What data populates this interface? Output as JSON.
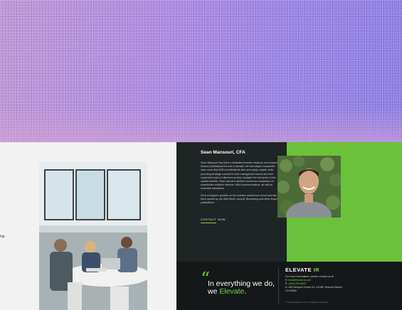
{
  "left": {
    "text_fragment": "hip"
  },
  "profile": {
    "name": "Sean Mansouri, CFA",
    "bio_1": "Sean Mansouri has been a dedicated investor relations and corporate finance professional for over a decade. He has helped companies raise more than $1B of institutional debt and equity capital, while providing strategic counsel to both management teams and their respective board of directors as they navigate the intricacies of the capital markets. Sean has also advised numerous companies on shareholder activism defense, M&A communications, as well as executive transitions.",
    "bio_2": "He is a frequent speaker on the investor conference circuit and has been quoted by the Wall Street Journal, Bloomberg and other financial publications.",
    "contact_label": "CONTACT NOW"
  },
  "quote": {
    "mark": "“",
    "line1": "In everything we do,",
    "line2_prefix": "we ",
    "line2_highlight": "Elevate",
    "line2_suffix": "."
  },
  "footer": {
    "logo_main": "ELEVATE",
    "logo_suffix": "IR",
    "intro": "For more information, please contact us at:",
    "email_label": "E: ",
    "email": "info@elevate-ir.com",
    "phone_label": "P: ",
    "phone": "(949) 200-8622",
    "address_line1": "A: 450 Newport Center Dr, #110B, Newport Beach,",
    "address_line2": "CA 92660",
    "copyright": "© 2022 Elevate IR, LLC. All Rights Reserved."
  },
  "colors": {
    "accent": "#6cc13a",
    "dark": "#1f2424",
    "hero_start": "#c29ad8",
    "hero_end": "#8f7fe6"
  }
}
